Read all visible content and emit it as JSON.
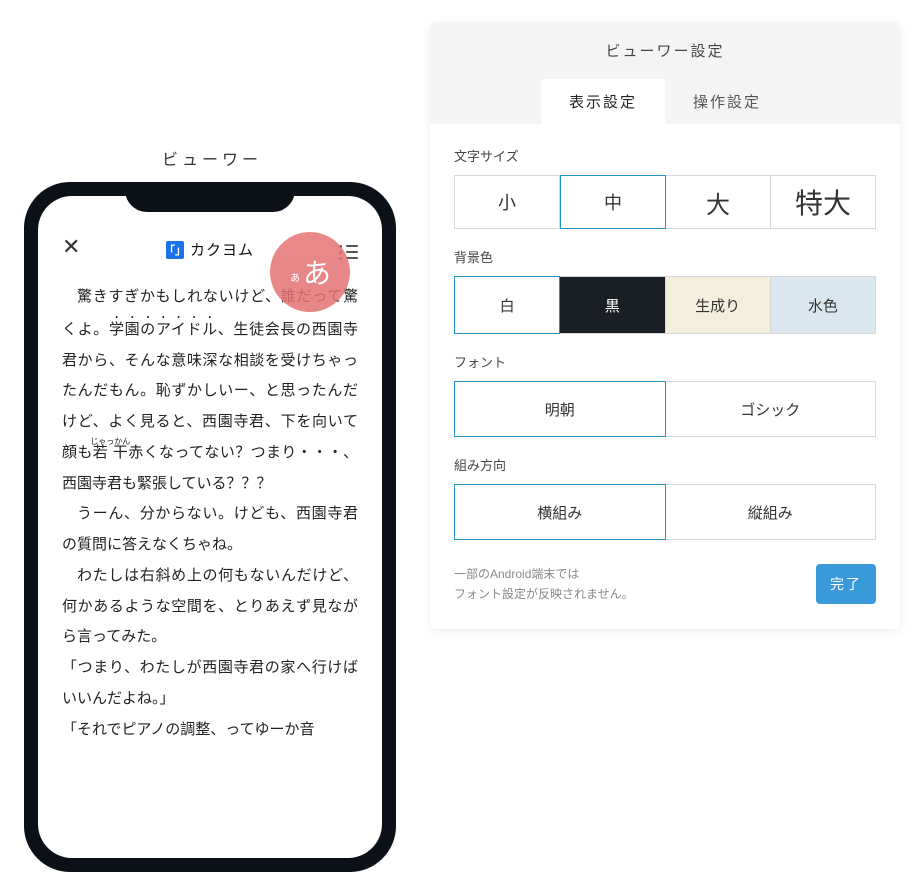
{
  "viewer_label": "ビューワー",
  "phone": {
    "brand_text": "カクヨム",
    "brand_glyph": "「」",
    "highlight_small": "ぁ",
    "highlight_big": "あ",
    "body_p1_a": "驚きすぎかもしれないけど、誰だって驚くよ。",
    "body_p1_b": "学園のアイドル",
    "body_p1_c": "、生徒会長の西園寺君から、そんな意味深な相談を受けちゃったんだもん。恥ずかしいー、と思ったんだけど、よく見ると、西園寺君、下を向いて顔も",
    "body_p1_ruby_base": "若干",
    "body_p1_ruby_rt": "じゃっかん",
    "body_p1_d": "赤くなってない？つまり・・・、西園寺君も緊張している？？？",
    "body_p2": "うーん、分からない。けども、西園寺君の質問に答えなくちゃね。",
    "body_p3": "わたしは右斜め上の何もないんだけど、何かあるような空間を、とりあえず見ながら言ってみた。",
    "body_p4": "「つまり、わたしが西園寺君の家へ行けばいいんだよね。」",
    "body_p5": "「それでピアノの調整、ってゆーか音"
  },
  "panel": {
    "title": "ビューワー設定",
    "tab1": "表示設定",
    "tab2": "操作設定",
    "size_label": "文字サイズ",
    "size_opts": [
      "小",
      "中",
      "大",
      "特大"
    ],
    "bg_label": "背景色",
    "bg_opts": [
      "白",
      "黒",
      "生成り",
      "水色"
    ],
    "font_label": "フォント",
    "font_opts": [
      "明朝",
      "ゴシック"
    ],
    "dir_label": "組み方向",
    "dir_opts": [
      "横組み",
      "縦組み"
    ],
    "note_l1": "一部のAndroid端末では",
    "note_l2": "フォント設定が反映されません。",
    "done": "完了"
  }
}
